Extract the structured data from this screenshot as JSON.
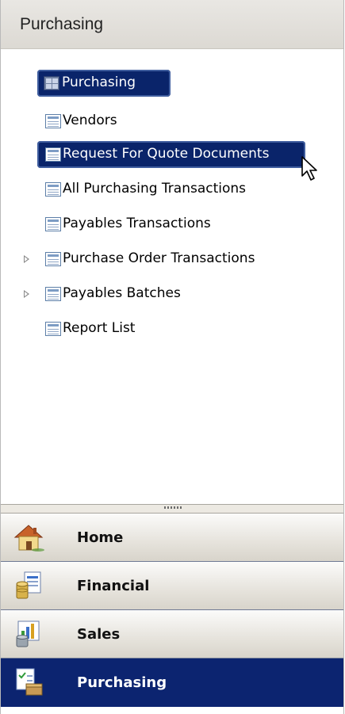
{
  "pane": {
    "title": "Purchasing"
  },
  "tree": {
    "items": [
      {
        "label": "Purchasing",
        "icon": "grid-icon",
        "selected": true,
        "expandable": false
      },
      {
        "label": "Vendors",
        "icon": "list-icon",
        "selected": false,
        "expandable": false
      },
      {
        "label": "Request For Quote Documents",
        "icon": "list-icon",
        "selected": true,
        "expandable": false
      },
      {
        "label": "All Purchasing Transactions",
        "icon": "list-icon",
        "selected": false,
        "expandable": false
      },
      {
        "label": "Payables Transactions",
        "icon": "list-icon",
        "selected": false,
        "expandable": false
      },
      {
        "label": "Purchase Order Transactions",
        "icon": "list-icon",
        "selected": false,
        "expandable": true
      },
      {
        "label": "Payables Batches",
        "icon": "list-icon",
        "selected": false,
        "expandable": true
      },
      {
        "label": "Report List",
        "icon": "list-icon",
        "selected": false,
        "expandable": false
      }
    ]
  },
  "nav": {
    "buttons": [
      {
        "label": "Home",
        "icon": "home-icon"
      },
      {
        "label": "Financial",
        "icon": "financial-icon"
      },
      {
        "label": "Sales",
        "icon": "sales-icon"
      },
      {
        "label": "Purchasing",
        "icon": "purchasing-icon",
        "active": true
      }
    ]
  },
  "colors": {
    "selection": "#0a246a",
    "active_nav": "#0c2470"
  }
}
